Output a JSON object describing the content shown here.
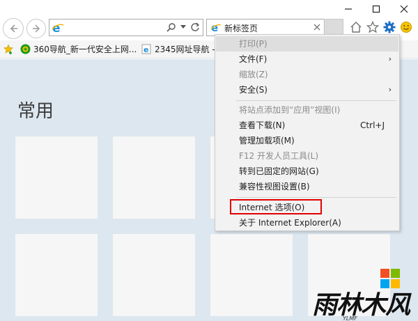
{
  "toolbar": {
    "address_value": "",
    "tab_title": "新标签页"
  },
  "favorites": [
    {
      "label": "360导航_新一代安全上网..."
    },
    {
      "label": "2345网址导航 -"
    }
  ],
  "content": {
    "heading": "常用"
  },
  "menu": {
    "items": [
      {
        "label": "打印(P)",
        "disabled": true
      },
      {
        "label": "文件(F)",
        "submenu": true
      },
      {
        "label": "缩放(Z)",
        "disabled": true
      },
      {
        "label": "安全(S)",
        "submenu": true
      },
      {
        "label": "将站点添加到“应用”视图(I)",
        "disabled": true
      },
      {
        "label": "查看下载(N)",
        "shortcut": "Ctrl+J"
      },
      {
        "label": "管理加载项(M)"
      },
      {
        "label": "F12 开发人员工具(L)",
        "disabled": true
      },
      {
        "label": "转到已固定的网站(G)"
      },
      {
        "label": "兼容性视图设置(B)"
      },
      {
        "label": "Internet 选项(O)",
        "highlighted_by_annotation": true
      },
      {
        "label": "关于 Internet Explorer(A)"
      }
    ],
    "submenu_arrow": "›"
  },
  "annotation": {
    "color": "#e00000"
  },
  "watermark": {
    "text": "雨林木风",
    "subtext": "YLMF",
    "logo_colors": [
      "#f25022",
      "#7fba00",
      "#00a4ef",
      "#ffb900"
    ]
  },
  "colors": {
    "content_bg": "#dde7f0",
    "menu_bg": "#f2f2f2",
    "ie_blue": "#1e8fd6",
    "gear_blue": "#1f6fc5"
  }
}
